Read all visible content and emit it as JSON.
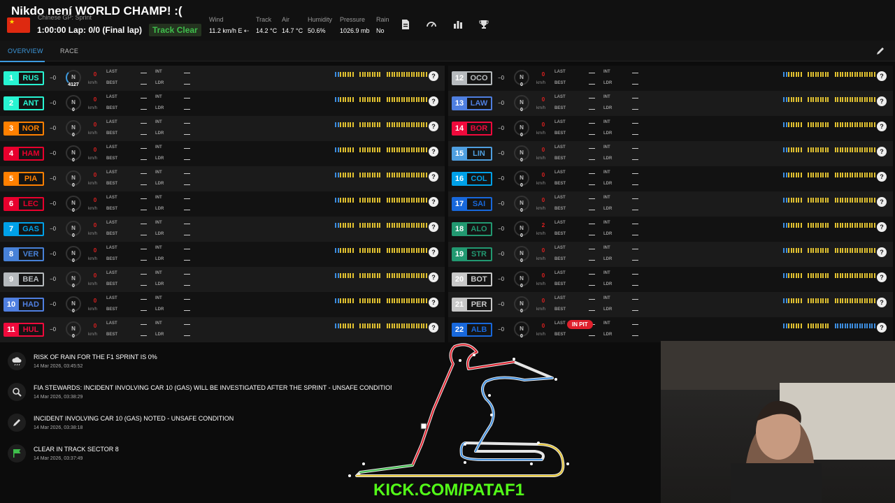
{
  "header": {
    "stream_title": "Nikdo není WORLD CHAMP! :(",
    "session_name": "Chinese GP: Sprint",
    "lap_text": "1:00:00 Lap: 0/0 (Final lap)",
    "track_status": "Track Clear",
    "weather": [
      {
        "label": "Wind",
        "value": "11.2 km/h E ⇠"
      },
      {
        "label": "Track",
        "value": "14.2 °C"
      },
      {
        "label": "Air",
        "value": "14.7 °C"
      },
      {
        "label": "Humidity",
        "value": "50.6%"
      },
      {
        "label": "Pressure",
        "value": "1026.9 mb"
      },
      {
        "label": "Rain",
        "value": "No"
      }
    ],
    "icons": [
      "document-icon",
      "speedometer-icon",
      "bar-chart-icon",
      "trophy-icon"
    ]
  },
  "tabs": [
    {
      "label": "OVERVIEW",
      "active": true
    },
    {
      "label": "RACE",
      "active": false
    }
  ],
  "labels": {
    "gap": "−0",
    "gear": "N",
    "rpm": "0",
    "speed": "0",
    "kmh": "km/h",
    "last": "LAST",
    "best": "BEST",
    "int": "INT",
    "ldr": "LDR",
    "question": "?",
    "in_pit": "IN PIT"
  },
  "drivers": [
    {
      "pos": "1",
      "code": "RUS",
      "color": "#27f4d2",
      "rpm": "4127",
      "speed": "0"
    },
    {
      "pos": "2",
      "code": "ANT",
      "color": "#27f4d2",
      "rpm": "0",
      "speed": "0"
    },
    {
      "pos": "3",
      "code": "NOR",
      "color": "#ff8000",
      "rpm": "0",
      "speed": "0"
    },
    {
      "pos": "4",
      "code": "HAM",
      "color": "#e8002d",
      "rpm": "0",
      "speed": "0"
    },
    {
      "pos": "5",
      "code": "PIA",
      "color": "#ff8000",
      "rpm": "0",
      "speed": "0"
    },
    {
      "pos": "6",
      "code": "LEC",
      "color": "#e8002d",
      "rpm": "0",
      "speed": "0"
    },
    {
      "pos": "7",
      "code": "GAS",
      "color": "#00a1e8",
      "rpm": "0",
      "speed": "0"
    },
    {
      "pos": "8",
      "code": "VER",
      "color": "#4781d7",
      "rpm": "0",
      "speed": "0"
    },
    {
      "pos": "9",
      "code": "BEA",
      "color": "#b6babd",
      "rpm": "0",
      "speed": "0"
    },
    {
      "pos": "10",
      "code": "HAD",
      "color": "#4f7fe0",
      "rpm": "0",
      "speed": "0"
    },
    {
      "pos": "11",
      "code": "HUL",
      "color": "#f00a3c",
      "rpm": "0",
      "speed": "0"
    },
    {
      "pos": "12",
      "code": "OCO",
      "color": "#b6babd",
      "rpm": "0",
      "speed": "0"
    },
    {
      "pos": "13",
      "code": "LAW",
      "color": "#4f7fe0",
      "rpm": "0",
      "speed": "0"
    },
    {
      "pos": "14",
      "code": "BOR",
      "color": "#f00a3c",
      "rpm": "0",
      "speed": "0"
    },
    {
      "pos": "15",
      "code": "LIN",
      "color": "#4f9fe0",
      "rpm": "0",
      "speed": "0"
    },
    {
      "pos": "16",
      "code": "COL",
      "color": "#00a1e8",
      "rpm": "0",
      "speed": "0"
    },
    {
      "pos": "17",
      "code": "SAI",
      "color": "#1868db",
      "rpm": "0",
      "speed": "0"
    },
    {
      "pos": "18",
      "code": "ALO",
      "color": "#229971",
      "rpm": "0",
      "speed": "2"
    },
    {
      "pos": "19",
      "code": "STR",
      "color": "#229971",
      "rpm": "0",
      "speed": "0"
    },
    {
      "pos": "20",
      "code": "BOT",
      "color": "#c8c8c8",
      "rpm": "0",
      "speed": "0"
    },
    {
      "pos": "21",
      "code": "PER",
      "color": "#c8c8c8",
      "rpm": "0",
      "speed": "0"
    },
    {
      "pos": "22",
      "code": "ALB",
      "color": "#1868db",
      "rpm": "0",
      "speed": "0",
      "in_pit": true
    }
  ],
  "messages": [
    {
      "icon": "rain-cloud-icon",
      "text": "RISK OF RAIN FOR THE F1 SPRINT IS 0%",
      "time": "14 Mar 2026, 03:45:52"
    },
    {
      "icon": "magnifier-icon",
      "text": "FIA STEWARDS: INCIDENT INVOLVING CAR 10 (GAS) WILL BE INVESTIGATED AFTER THE SPRINT - UNSAFE CONDITION",
      "time": "14 Mar 2026, 03:38:29"
    },
    {
      "icon": "pencil-icon",
      "text": "INCIDENT INVOLVING CAR 10 (GAS) NOTED - UNSAFE CONDITION",
      "time": "14 Mar 2026, 03:38:18"
    },
    {
      "icon": "green-flag-icon",
      "text": "CLEAR IN TRACK SECTOR 8",
      "time": "14 Mar 2026, 03:37:49"
    }
  ],
  "stream_url": "KICK.COM/PATAF1",
  "colors": {
    "accent": "#3d9be0",
    "track_clear": "#3fbf4c",
    "speed_red": "#e02020",
    "sector_yellow": "#e2c230",
    "sector_blue": "#3d8ee0",
    "kick_green": "#53fc18"
  }
}
